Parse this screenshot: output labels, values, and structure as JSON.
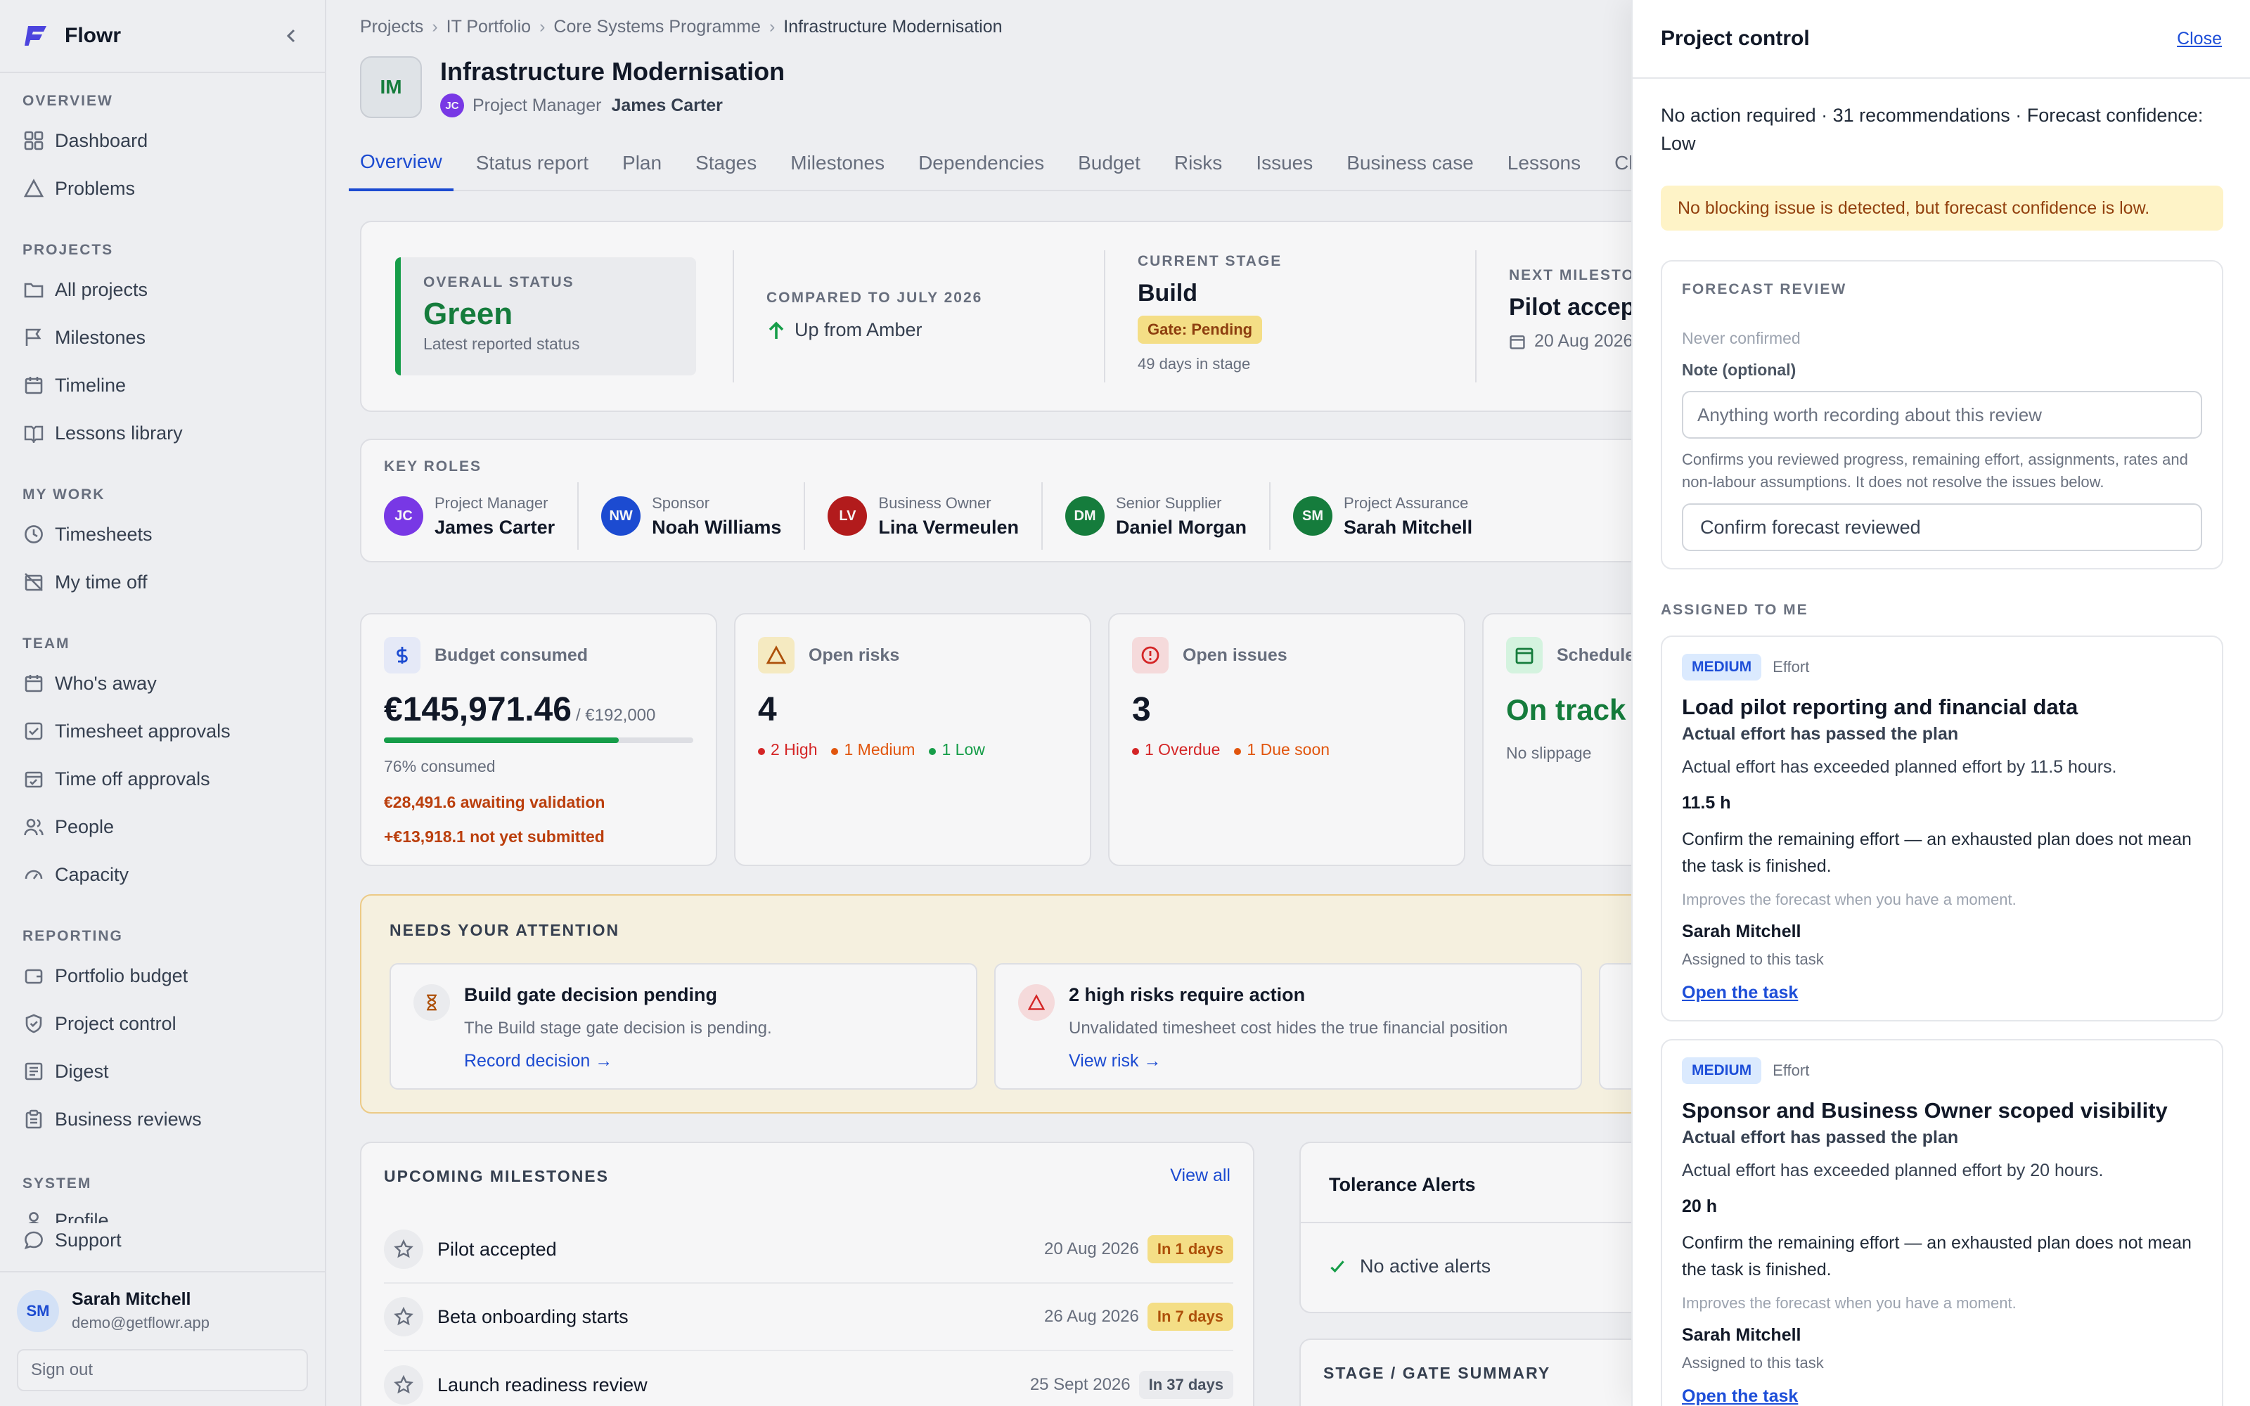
{
  "app": {
    "name": "Flowr"
  },
  "sidebar": {
    "sections": [
      {
        "title": "OVERVIEW",
        "items": [
          {
            "label": "Dashboard",
            "icon": "grid-icon"
          },
          {
            "label": "Problems",
            "icon": "warning-icon"
          }
        ]
      },
      {
        "title": "PROJECTS",
        "items": [
          {
            "label": "All projects",
            "icon": "folder-icon"
          },
          {
            "label": "Milestones",
            "icon": "flag-icon"
          },
          {
            "label": "Timeline",
            "icon": "calendar-icon"
          },
          {
            "label": "Lessons library",
            "icon": "book-icon"
          }
        ]
      },
      {
        "title": "MY WORK",
        "items": [
          {
            "label": "Timesheets",
            "icon": "clock-icon"
          },
          {
            "label": "My time off",
            "icon": "calendar-off-icon"
          }
        ]
      },
      {
        "title": "TEAM",
        "items": [
          {
            "label": "Who's away",
            "icon": "calendar-icon"
          },
          {
            "label": "Timesheet approvals",
            "icon": "check-square-icon"
          },
          {
            "label": "Time off approvals",
            "icon": "calendar-check-icon"
          },
          {
            "label": "People",
            "icon": "users-icon"
          },
          {
            "label": "Capacity",
            "icon": "gauge-icon"
          }
        ]
      },
      {
        "title": "REPORTING",
        "items": [
          {
            "label": "Portfolio budget",
            "icon": "wallet-icon"
          },
          {
            "label": "Project control",
            "icon": "shield-icon"
          },
          {
            "label": "Digest",
            "icon": "newspaper-icon"
          },
          {
            "label": "Business reviews",
            "icon": "clipboard-icon"
          }
        ]
      },
      {
        "title": "SYSTEM",
        "items": [
          {
            "label": "Profile",
            "icon": "user-icon"
          }
        ]
      }
    ],
    "support_label": "Support",
    "user": {
      "initials": "SM",
      "name": "Sarah Mitchell",
      "email": "demo@getflowr.app"
    },
    "signout_label": "Sign out"
  },
  "breadcrumb": [
    "Projects",
    "IT Portfolio",
    "Core Systems Programme",
    "Infrastructure Modernisation"
  ],
  "project": {
    "initials": "IM",
    "title": "Infrastructure Modernisation",
    "pm_initials": "JC",
    "pm_label": "Project Manager",
    "pm_name": "James Carter"
  },
  "tabs": [
    "Overview",
    "Status report",
    "Plan",
    "Stages",
    "Milestones",
    "Dependencies",
    "Budget",
    "Risks",
    "Issues",
    "Business case",
    "Lessons",
    "Closure"
  ],
  "status": {
    "overall_label": "OVERALL STATUS",
    "overall_value": "Green",
    "overall_sub": "Latest reported status",
    "compared_label": "COMPARED TO JULY 2026",
    "compared_value": "Up from Amber",
    "stage_label": "CURRENT STAGE",
    "stage_value": "Build",
    "stage_gate": "Gate: Pending",
    "stage_days": "49 days in stage",
    "milestone_label": "NEXT MILESTONE",
    "milestone_value": "Pilot accepted",
    "milestone_date": "20 Aug 2026"
  },
  "roles": {
    "title": "KEY ROLES",
    "items": [
      {
        "initials": "JC",
        "role": "Project Manager",
        "name": "James Carter",
        "color": "#7c3aed"
      },
      {
        "initials": "NW",
        "role": "Sponsor",
        "name": "Noah Williams",
        "color": "#1d4ed8"
      },
      {
        "initials": "LV",
        "role": "Business Owner",
        "name": "Lina Vermeulen",
        "color": "#b91c1c"
      },
      {
        "initials": "DM",
        "role": "Senior Supplier",
        "name": "Daniel Morgan",
        "color": "#15803d"
      },
      {
        "initials": "SM",
        "role": "Project Assurance",
        "name": "Sarah Mitchell",
        "color": "#15803d"
      }
    ]
  },
  "metrics": {
    "budget": {
      "label": "Budget consumed",
      "value": "€145,971.46",
      "total": "/ €192,000",
      "consumed_pct": 76,
      "consumed_text": "76% consumed",
      "awaiting": "€28,491.6 awaiting validation",
      "not_submitted": "+€13,918.1 not yet submitted"
    },
    "risks": {
      "label": "Open risks",
      "value": "4",
      "high": "2 High",
      "medium": "1 Medium",
      "low": "1 Low"
    },
    "issues": {
      "label": "Open issues",
      "value": "3",
      "overdue": "1 Overdue",
      "due_soon": "1 Due soon"
    },
    "schedule": {
      "label": "Schedule",
      "value": "On track",
      "sub": "No slippage"
    }
  },
  "attention": {
    "title": "NEEDS YOUR ATTENTION",
    "items": [
      {
        "title": "Build gate decision pending",
        "desc": "The Build stage gate decision is pending.",
        "action": "Record decision →"
      },
      {
        "title": "2 high risks require action",
        "desc": "Unvalidated timesheet cost hides the true financial position",
        "action": "View risk →"
      }
    ]
  },
  "milestones": {
    "title": "UPCOMING MILESTONES",
    "view_all": "View all",
    "items": [
      {
        "name": "Pilot accepted",
        "date": "20 Aug 2026",
        "badge": "In 1 days"
      },
      {
        "name": "Beta onboarding starts",
        "date": "26 Aug 2026",
        "badge": "In 7 days"
      },
      {
        "name": "Launch readiness review",
        "date": "25 Sept 2026",
        "badge": "In 37 days"
      }
    ]
  },
  "tolerance": {
    "title": "Tolerance Alerts",
    "empty": "No active alerts"
  },
  "stage_gate": {
    "title": "STAGE / GATE SUMMARY"
  },
  "panel": {
    "title": "Project control",
    "close": "Close",
    "summary": "No action required · 31 recommendations · Forecast confidence: Low",
    "warning": "No blocking issue is detected, but forecast confidence is low.",
    "forecast": {
      "title": "FORECAST REVIEW",
      "never": "Never confirmed",
      "note_label": "Note (optional)",
      "note_placeholder": "Anything worth recording about this review",
      "help": "Confirms you reviewed progress, remaining effort, assignments, rates and non-labour assumptions. It does not resolve the issues below.",
      "confirm": "Confirm forecast reviewed"
    },
    "assigned_title": "ASSIGNED TO ME",
    "tasks": [
      {
        "severity": "MEDIUM",
        "category": "Effort",
        "title": "Load pilot reporting and financial data",
        "subtitle": "Actual effort has passed the plan",
        "desc": "Actual effort has exceeded planned effort by 11.5 hours.",
        "hours": "11.5 h",
        "instruction": "Confirm the remaining effort — an exhausted plan does not mean the task is finished.",
        "hint": "Improves the forecast when you have a moment.",
        "assignee": "Sarah Mitchell",
        "assignee_sub": "Assigned to this task",
        "open": "Open the task"
      },
      {
        "severity": "MEDIUM",
        "category": "Effort",
        "title": "Sponsor and Business Owner scoped visibility",
        "subtitle": "Actual effort has passed the plan",
        "desc": "Actual effort has exceeded planned effort by 20 hours.",
        "hours": "20 h",
        "instruction": "Confirm the remaining effort — an exhausted plan does not mean the task is finished.",
        "hint": "Improves the forecast when you have a moment.",
        "assignee": "Sarah Mitchell",
        "assignee_sub": "Assigned to this task",
        "open": "Open the task"
      }
    ]
  }
}
